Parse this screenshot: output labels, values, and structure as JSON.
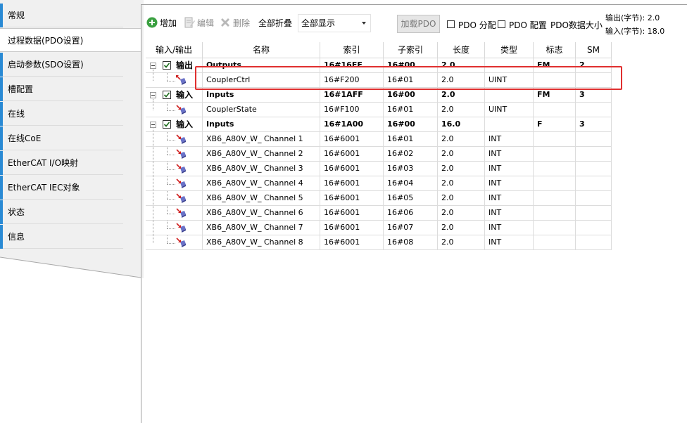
{
  "sidebar": {
    "items": [
      {
        "label": "常规"
      },
      {
        "label": "过程数据(PDO设置)"
      },
      {
        "label": "启动参数(SDO设置)"
      },
      {
        "label": "槽配置"
      },
      {
        "label": "在线"
      },
      {
        "label": "在线CoE"
      },
      {
        "label": "EtherCAT I/O映射"
      },
      {
        "label": "EtherCAT IEC对象"
      },
      {
        "label": "状态"
      },
      {
        "label": "信息"
      }
    ],
    "active_index": 1,
    "accent_color": "#2a8ad4"
  },
  "toolbar": {
    "add_label": "增加",
    "edit_label": "编辑",
    "delete_label": "删除",
    "collapse_all_label": "全部折叠",
    "filter_value": "全部显示",
    "load_pdo_label": "加载PDO",
    "pdo_assign_label": "PDO 分配",
    "pdo_config_label": "PDO 配置",
    "pdo_size_label": "PDO数据大小",
    "output_size": "输出(字节): 2.0",
    "input_size": "输入(字节): 18.0",
    "icons": {
      "add": "add-circle-green-icon",
      "edit": "edit-page-icon",
      "delete": "delete-x-icon"
    }
  },
  "table": {
    "headers": [
      "输入/输出",
      "名称",
      "索引",
      "子索引",
      "长度",
      "类型",
      "标志",
      "SM"
    ],
    "rows": [
      {
        "group": true,
        "io": "输出",
        "name": "Outputs",
        "index": "16#16FF",
        "subindex": "16#00",
        "length": "2.0",
        "type": "",
        "flag": "FM",
        "sm": "2"
      },
      {
        "group": false,
        "direction": "out",
        "name": "CouplerCtrl",
        "index": "16#F200",
        "subindex": "16#01",
        "length": "2.0",
        "type": "UINT",
        "flag": "",
        "sm": ""
      },
      {
        "group": true,
        "io": "输入",
        "name": "Inputs",
        "index": "16#1AFF",
        "subindex": "16#00",
        "length": "2.0",
        "type": "",
        "flag": "FM",
        "sm": "3"
      },
      {
        "group": false,
        "direction": "in",
        "name": "CouplerState",
        "index": "16#F100",
        "subindex": "16#01",
        "length": "2.0",
        "type": "UINT",
        "flag": "",
        "sm": ""
      },
      {
        "group": true,
        "io": "输入",
        "name": "Inputs",
        "index": "16#1A00",
        "subindex": "16#00",
        "length": "16.0",
        "type": "",
        "flag": "F",
        "sm": "3"
      },
      {
        "group": false,
        "direction": "in",
        "name": "XB6_A80V_W_ Channel 1",
        "index": "16#6001",
        "subindex": "16#01",
        "length": "2.0",
        "type": "INT",
        "flag": "",
        "sm": ""
      },
      {
        "group": false,
        "direction": "in",
        "name": "XB6_A80V_W_ Channel 2",
        "index": "16#6001",
        "subindex": "16#02",
        "length": "2.0",
        "type": "INT",
        "flag": "",
        "sm": ""
      },
      {
        "group": false,
        "direction": "in",
        "name": "XB6_A80V_W_ Channel 3",
        "index": "16#6001",
        "subindex": "16#03",
        "length": "2.0",
        "type": "INT",
        "flag": "",
        "sm": ""
      },
      {
        "group": false,
        "direction": "in",
        "name": "XB6_A80V_W_ Channel 4",
        "index": "16#6001",
        "subindex": "16#04",
        "length": "2.0",
        "type": "INT",
        "flag": "",
        "sm": ""
      },
      {
        "group": false,
        "direction": "in",
        "name": "XB6_A80V_W_ Channel 5",
        "index": "16#6001",
        "subindex": "16#05",
        "length": "2.0",
        "type": "INT",
        "flag": "",
        "sm": ""
      },
      {
        "group": false,
        "direction": "in",
        "name": "XB6_A80V_W_ Channel 6",
        "index": "16#6001",
        "subindex": "16#06",
        "length": "2.0",
        "type": "INT",
        "flag": "",
        "sm": ""
      },
      {
        "group": false,
        "direction": "in",
        "name": "XB6_A80V_W_ Channel 7",
        "index": "16#6001",
        "subindex": "16#07",
        "length": "2.0",
        "type": "INT",
        "flag": "",
        "sm": ""
      },
      {
        "group": false,
        "direction": "in",
        "name": "XB6_A80V_W_ Channel 8",
        "index": "16#6001",
        "subindex": "16#08",
        "length": "2.0",
        "type": "INT",
        "flag": "",
        "sm": ""
      }
    ]
  },
  "annotation": {
    "highlight_color": "#e03030"
  }
}
